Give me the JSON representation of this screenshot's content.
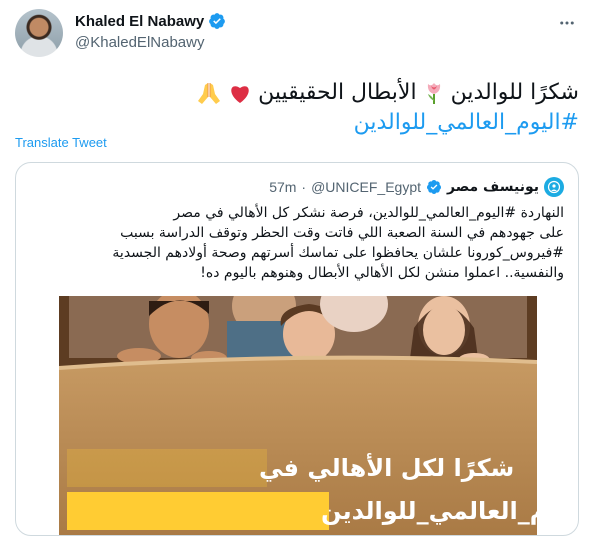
{
  "author": {
    "display_name": "Khaled El Nabawy",
    "handle": "@KhaledElNabawy"
  },
  "tweet": {
    "line1_text": "شكرًا للوالدين",
    "line1_text2": "الأبطال الحقيقيين",
    "line2_hashtag": "#اليوم_العالمي_للوالدين"
  },
  "translate_label": "Translate Tweet",
  "quote": {
    "name": "يونيسف مصر",
    "handle": "@UNICEF_Egypt",
    "dot": "·",
    "time": "57m",
    "lines": [
      "النهاردة #اليوم_العالمي_للوالدين، فرصة نشكر كل الأهالي في مصر",
      "على جهودهم في السنة الصعبة اللي فاتت وقت الحظر وتوقف الدراسة بسبب",
      "#فيروس_كورونا علشان يحافظوا على تماسك أسرتهم وصحة أولادهم الجسدية",
      "والنفسية.. اعملوا منشن لكل الأهالي الأبطال وهنوهم باليوم ده!"
    ],
    "image_caption_line1": "شكرًا لكل الأهالي في",
    "image_caption_line2": "#اليوم_العالمي_للوالدين"
  },
  "colors": {
    "accent": "#1d9bf0",
    "verified": "#1d9bf0",
    "heart": "#e0245e",
    "caption_bg": "#ffcc33",
    "unicef_blue": "#1cabe2"
  }
}
